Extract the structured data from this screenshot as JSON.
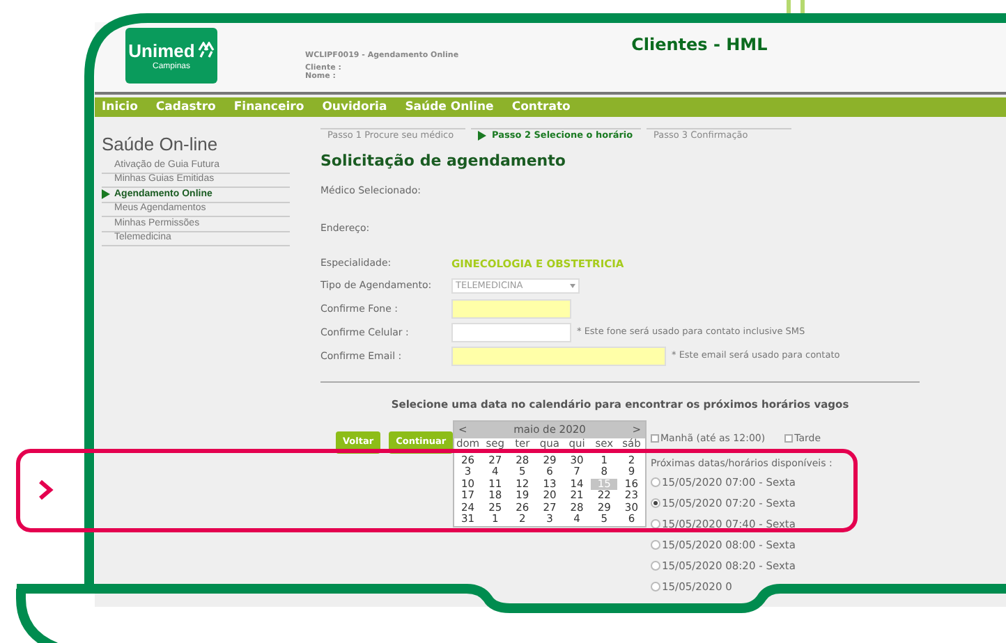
{
  "header": {
    "logo_text": "Unimed",
    "logo_subtext": "Campinas",
    "system_title": "Clientes - HML",
    "page_code": "WCLIPF0019 - Agendamento Online",
    "client_label": "Cliente :",
    "name_label": "Nome :"
  },
  "nav": [
    "Inicio",
    "Cadastro",
    "Financeiro",
    "Ouvidoria",
    "Saúde Online",
    "Contrato"
  ],
  "sidebar": {
    "title": "Saúde On-line",
    "items": [
      {
        "label": "Ativação de Guia Futura",
        "selected": false
      },
      {
        "label": "Minhas Guias Emitidas",
        "selected": false
      },
      {
        "label": "Agendamento Online",
        "selected": true
      },
      {
        "label": "Meus Agendamentos",
        "selected": false
      },
      {
        "label": "Minhas Permissões",
        "selected": false
      },
      {
        "label": "Telemedicina",
        "selected": false
      }
    ]
  },
  "steps": [
    {
      "label": "Passo 1 Procure seu médico",
      "selected": false
    },
    {
      "label": "Passo 2 Selecione o horário",
      "selected": true
    },
    {
      "label": "Passo 3 Confirmação",
      "selected": false
    }
  ],
  "form": {
    "title": "Solicitação de agendamento",
    "fields": [
      {
        "kind": "empty",
        "label": "Médico Selecionado:"
      },
      {
        "kind": "empty",
        "label": "Endereço:"
      },
      {
        "kind": "value",
        "label": "Especialidade:",
        "value": "GINECOLOGIA E OBSTETRICIA"
      },
      {
        "kind": "select",
        "label": "Tipo de Agendamento:",
        "value": "TELEMEDICINA"
      },
      {
        "kind": "short_input",
        "label": "Confirme Fone :",
        "required": true
      },
      {
        "kind": "short_input",
        "label": "Confirme Celular :",
        "required": false,
        "note": "* Este fone será usado para contato inclusive SMS"
      },
      {
        "kind": "long_input",
        "label": "Confirme Email :",
        "required": true,
        "note": "* Este email será usado para contato"
      }
    ]
  },
  "calendar_prompt": "Selecione uma data no calendário para encontrar os próximos horários vagos",
  "buttons": [
    "Voltar",
    "Continuar"
  ],
  "calendar": {
    "prev": "<",
    "month": "maio de 2020",
    "next": ">",
    "weekdays": [
      "dom",
      "seg",
      "ter",
      "qua",
      "qui",
      "sex",
      "sáb"
    ],
    "weeks": [
      [
        {
          "day": "26",
          "selected": false
        },
        {
          "day": "27",
          "selected": false
        },
        {
          "day": "28",
          "selected": false
        },
        {
          "day": "29",
          "selected": false
        },
        {
          "day": "30",
          "selected": false
        },
        {
          "day": "1",
          "selected": false
        },
        {
          "day": "2",
          "selected": false
        }
      ],
      [
        {
          "day": "3",
          "selected": false
        },
        {
          "day": "4",
          "selected": false
        },
        {
          "day": "5",
          "selected": false
        },
        {
          "day": "6",
          "selected": false
        },
        {
          "day": "7",
          "selected": false
        },
        {
          "day": "8",
          "selected": false
        },
        {
          "day": "9",
          "selected": false
        }
      ],
      [
        {
          "day": "10",
          "selected": false
        },
        {
          "day": "11",
          "selected": false
        },
        {
          "day": "12",
          "selected": false
        },
        {
          "day": "13",
          "selected": false
        },
        {
          "day": "14",
          "selected": false
        },
        {
          "day": "15",
          "selected": true
        },
        {
          "day": "16",
          "selected": false
        }
      ],
      [
        {
          "day": "17",
          "selected": false
        },
        {
          "day": "18",
          "selected": false
        },
        {
          "day": "19",
          "selected": false
        },
        {
          "day": "20",
          "selected": false
        },
        {
          "day": "21",
          "selected": false
        },
        {
          "day": "22",
          "selected": false
        },
        {
          "day": "23",
          "selected": false
        }
      ],
      [
        {
          "day": "24",
          "selected": false
        },
        {
          "day": "25",
          "selected": false
        },
        {
          "day": "26",
          "selected": false
        },
        {
          "day": "27",
          "selected": false
        },
        {
          "day": "28",
          "selected": false
        },
        {
          "day": "29",
          "selected": false
        },
        {
          "day": "30",
          "selected": false
        }
      ],
      [
        {
          "day": "31",
          "selected": false
        },
        {
          "day": "1",
          "selected": false
        },
        {
          "day": "2",
          "selected": false
        },
        {
          "day": "3",
          "selected": false
        },
        {
          "day": "4",
          "selected": false
        },
        {
          "day": "5",
          "selected": false
        },
        {
          "day": "6",
          "selected": false
        }
      ]
    ]
  },
  "period_filters": [
    {
      "label": "Manhã (até as 12:00)",
      "checked": false
    },
    {
      "label": "Tarde",
      "checked": false
    }
  ],
  "slots_label": "Próximas datas/horários disponíveis :",
  "slots": [
    {
      "label": "15/05/2020 07:00 - Sexta",
      "selected": false
    },
    {
      "label": "15/05/2020 07:20 - Sexta",
      "selected": true
    },
    {
      "label": "15/05/2020 07:40 - Sexta",
      "selected": false
    },
    {
      "label": "15/05/2020 08:00 - Sexta",
      "selected": false
    },
    {
      "label": "15/05/2020 08:20 - Sexta",
      "selected": false
    },
    {
      "label": "15/05/2020 0",
      "selected": false
    }
  ]
}
